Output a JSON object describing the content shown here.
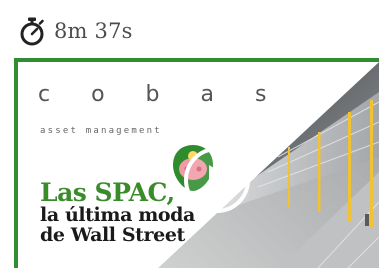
{
  "duration": {
    "text": "8m 37s",
    "icon": "stopwatch-icon",
    "color": "#4d4d4d"
  },
  "video": {
    "brand_name": "c o b a s",
    "brand_subtitle": "asset management",
    "headline": {
      "line1": "Las SPAC,",
      "line2": "la última moda",
      "line3": "de Wall Street"
    },
    "colors": {
      "border": "#2f8e2f",
      "headline_accent": "#3a8c2a",
      "headline_text": "#1a1a1a"
    },
    "play_icon": "play-icon"
  }
}
